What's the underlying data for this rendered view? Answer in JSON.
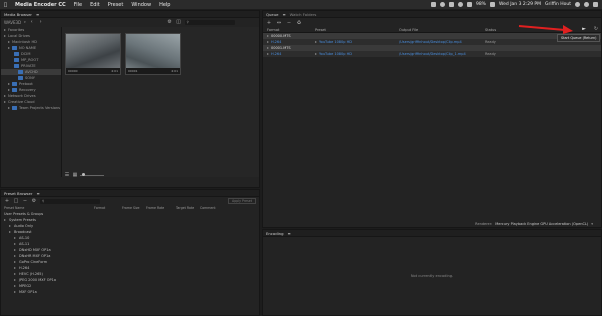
{
  "menubar": {
    "app": "Media Encoder CC",
    "items": [
      "File",
      "Edit",
      "Preset",
      "Window",
      "Help"
    ],
    "battery": "98%",
    "datetime": "Wed Jan 3  2:29 PM",
    "user": "Griffin Hout"
  },
  "media_browser": {
    "title": "Media Browser",
    "path": "WAVE3D",
    "tree": [
      {
        "label": "Favorites",
        "level": 0
      },
      {
        "label": "Local Drives",
        "level": 0
      },
      {
        "label": "Macintosh HD",
        "level": 1
      },
      {
        "label": "NO NAME",
        "level": 1
      },
      {
        "label": "DCIM",
        "level": 2
      },
      {
        "label": "MP_ROOT",
        "level": 2
      },
      {
        "label": "PRIVATE",
        "level": 2
      },
      {
        "label": "AVCHD",
        "level": 3
      },
      {
        "label": "SONY",
        "level": 3
      },
      {
        "label": "Preboot",
        "level": 1
      },
      {
        "label": "Recovery",
        "level": 1
      },
      {
        "label": "Network Drives",
        "level": 0
      },
      {
        "label": "Creative Cloud",
        "level": 0
      },
      {
        "label": "Team Projects Versions",
        "level": 1
      }
    ],
    "thumbs": [
      {
        "name": "00000",
        "duration": "4:01"
      },
      {
        "name": "00001",
        "duration": "4:01"
      }
    ]
  },
  "preset_browser": {
    "title": "Preset Browser",
    "apply_label": "Apply Preset",
    "columns": [
      "Preset Name",
      "Format",
      "Frame Size",
      "Frame Rate",
      "Target Rate",
      "Comment"
    ],
    "groups": [
      "User Presets & Groups",
      "System Presets"
    ],
    "items": [
      "Audio Only",
      "Broadcast",
      "AS-10",
      "AS-11",
      "DNxHD MXF OP1a",
      "DNxHR MXF OP1a",
      "GoPro CineForm",
      "H.264",
      "HEVC (H.265)",
      "JPEG 2000 MXF OP1a",
      "MPEG2",
      "MXF OP1a"
    ]
  },
  "queue": {
    "tabs": [
      "Queue",
      "Watch Folders"
    ],
    "columns": [
      "Format",
      "Preset",
      "Output File",
      "Status"
    ],
    "groups": [
      {
        "name": "00000.MTS",
        "format": "H.264",
        "preset": "YouTube 1080p HD",
        "output": "/Users/griffinhout/Desktop/Clip.mp4",
        "status": "Ready"
      },
      {
        "name": "00001.MTS",
        "format": "H.264",
        "preset": "YouTube 1080p HD",
        "output": "/Users/griffinhout/Desktop/Clip_1.mp4",
        "status": "Ready"
      }
    ],
    "renderer_label": "Renderer:",
    "renderer_value": "Mercury Playback Engine GPU Acceleration (OpenCL)",
    "tooltip": "Start Queue (Return)"
  },
  "encoding": {
    "title": "Encoding",
    "empty": "Not currently encoding."
  },
  "colors": {
    "accent": "#4a90e2",
    "arrow": "#e02020",
    "folder": "#3a6fb5"
  }
}
